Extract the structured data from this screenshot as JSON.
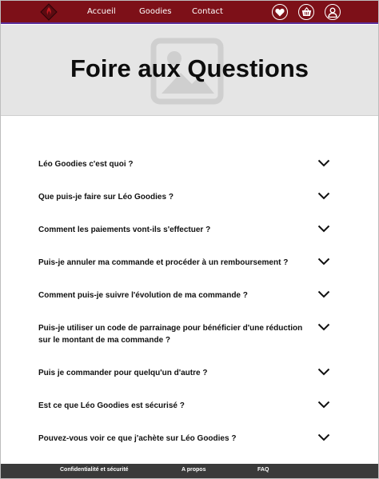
{
  "colors": {
    "topbar": "#7d1018",
    "footer": "#3a3a3a",
    "hero": "#e5e5e5"
  },
  "header": {
    "logo_icon": "flame-diamond-logo",
    "nav": {
      "accueil": "Accueil",
      "goodies": "Goodies",
      "contact": "Contact"
    },
    "icons": [
      "heart-icon",
      "basket-icon",
      "user-icon"
    ]
  },
  "hero": {
    "title": "Foire aux Questions",
    "image_icon": "image-placeholder-icon"
  },
  "faq": {
    "items": [
      "Léo Goodies c'est quoi ?",
      "Que puis-je faire sur Léo Goodies ?",
      "Comment les paiements vont-ils s'effectuer ?",
      "Puis-je annuler ma commande et procéder à un remboursement ?",
      "Comment puis-je suivre l'évolution de ma commande ?",
      "Puis-je utiliser un code de parrainage pour bénéficier d'une réduction sur le montant de ma commande ?",
      "Puis je commander pour quelqu'un d'autre ?",
      "Est ce que Léo Goodies est sécurisé ?",
      "Pouvez-vous voir ce que j'achète sur Léo Goodies ?"
    ]
  },
  "footer": {
    "privacy": "Confidentialité et sécurité",
    "about": "A propos",
    "faq": "FAQ"
  }
}
